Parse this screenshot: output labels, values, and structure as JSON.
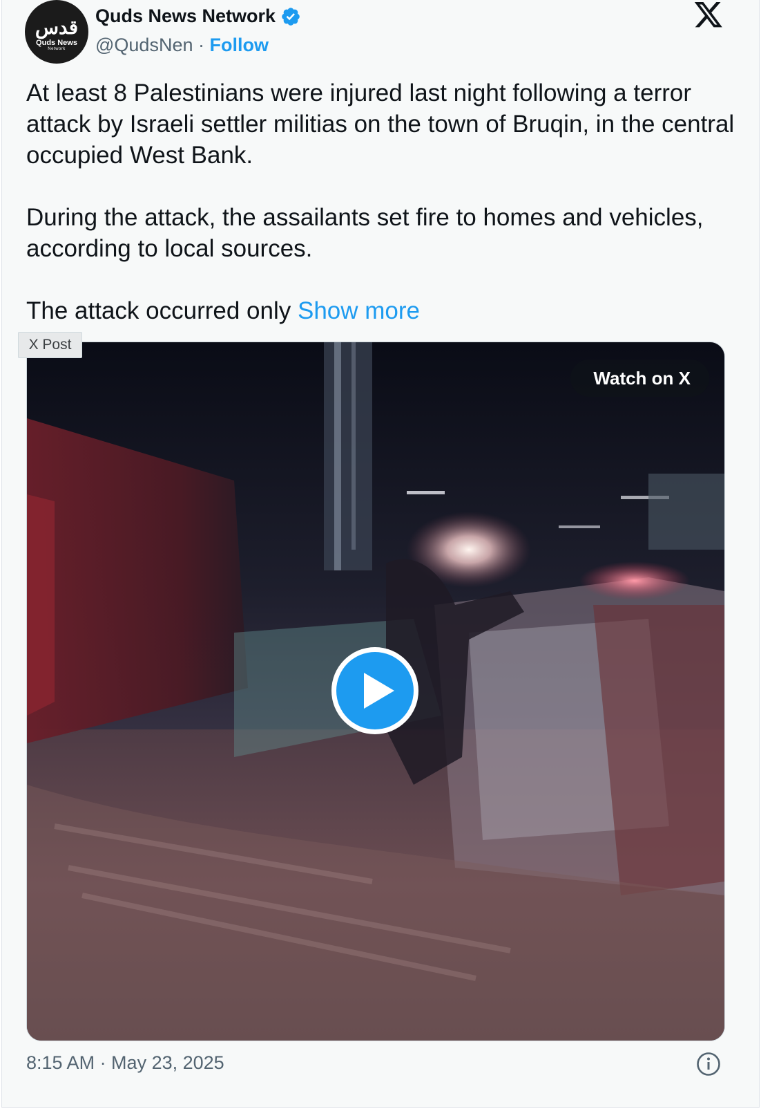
{
  "author": {
    "name": "Quds News Network",
    "handle": "@QudsNen",
    "separator": "·",
    "follow_label": "Follow",
    "avatar_logo_text": "قدس",
    "avatar_subtitle": "Quds News",
    "avatar_subtitle_small": "Network",
    "verified_icon": "verified-badge-icon"
  },
  "post": {
    "paragraphs": [
      "At least 8 Palestinians were injured last night following a terror attack by Israeli settler militias on the town of Bruqin, in the central occupied West Bank.",
      "During the attack, the assailants set fire to homes and vehicles, according to local sources."
    ],
    "truncated_text": "The attack occurred only ",
    "show_more_label": "Show more"
  },
  "media": {
    "type_badge": "X Post",
    "watch_label": "Watch on X",
    "play_icon": "play-icon"
  },
  "footer": {
    "timestamp": "8:15 AM · May 23, 2025",
    "info_icon": "info-icon"
  },
  "colors": {
    "accent": "#1d9bf0",
    "text": "#0f1419",
    "muted": "#536471",
    "background": "#f7f9f9"
  }
}
